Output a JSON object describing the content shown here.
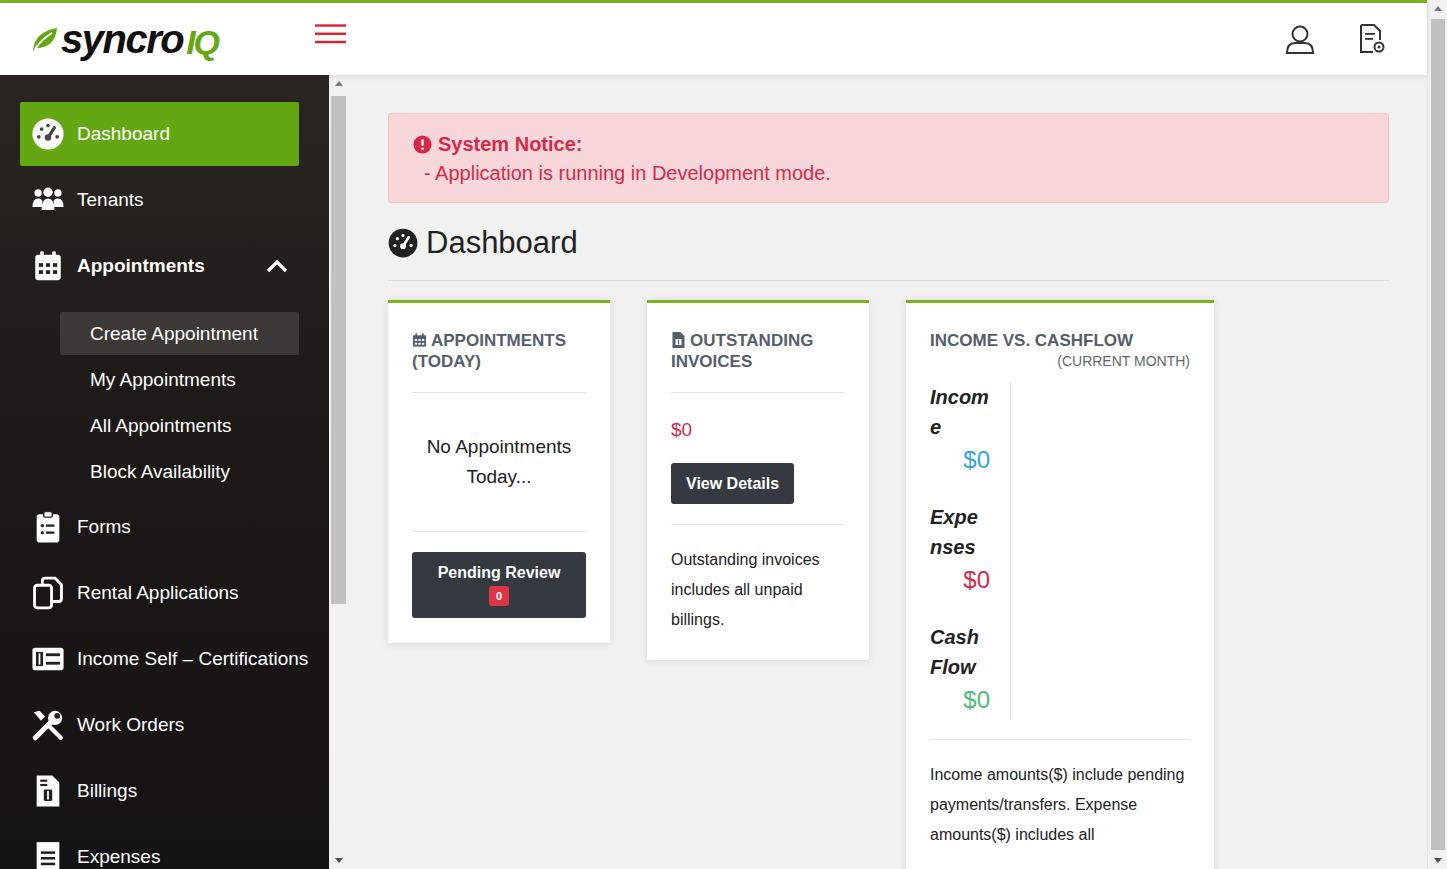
{
  "brand": {
    "name": "syncro",
    "suffix": "IQ"
  },
  "sidebar": {
    "items": [
      {
        "label": "Dashboard",
        "kind": "link",
        "selected": true
      },
      {
        "label": "Tenants",
        "kind": "link",
        "selected": false
      },
      {
        "label": "Appointments",
        "kind": "group",
        "selected": false,
        "expanded": true,
        "children": [
          {
            "label": "Create Appointment",
            "selected": true
          },
          {
            "label": "My Appointments",
            "selected": false
          },
          {
            "label": "All Appointments",
            "selected": false
          },
          {
            "label": "Block Availability",
            "selected": false
          }
        ]
      },
      {
        "label": "Forms",
        "kind": "link",
        "selected": false
      },
      {
        "label": "Rental Applications",
        "kind": "link",
        "selected": false
      },
      {
        "label": "Income Self – Certifications",
        "kind": "link",
        "selected": false
      },
      {
        "label": "Work Orders",
        "kind": "link",
        "selected": false
      },
      {
        "label": "Billings",
        "kind": "link",
        "selected": false
      },
      {
        "label": "Expenses",
        "kind": "link",
        "selected": false
      }
    ]
  },
  "notice": {
    "title": "System Notice:",
    "lines": [
      "- Application is running in Development mode."
    ]
  },
  "page": {
    "title": "Dashboard"
  },
  "cards": {
    "appointments": {
      "title": "APPOINTMENTS (TODAY)",
      "empty": "No Appointments Today...",
      "button": "Pending Review",
      "badge": "0"
    },
    "invoices": {
      "title": "OUTSTANDING INVOICES",
      "amount": "$0",
      "button": "View Details",
      "note": "Outstanding invoices includes all unpaid billings."
    },
    "cashflow": {
      "title": "INCOME VS. CASHFLOW",
      "subtitle": "(CURRENT MONTH)",
      "metrics": [
        {
          "label": "Income",
          "value": "$0",
          "color": "#36a3e0"
        },
        {
          "label": "Expenses",
          "value": "$0",
          "color": "#d6294a"
        },
        {
          "label": "Cash Flow",
          "value": "$0",
          "color": "#4dbd74"
        }
      ],
      "note": "Income amounts($) include pending payments/transfers. Expense amounts($) includes all"
    }
  }
}
